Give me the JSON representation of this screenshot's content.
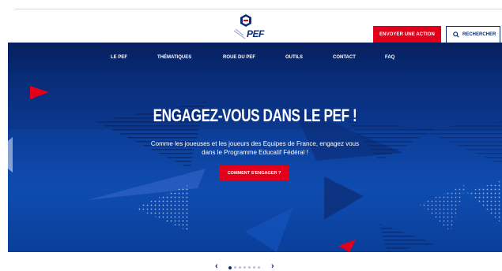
{
  "header": {
    "logo_text": "PEF",
    "primary_cta": "ENVOYER UNE ACTION",
    "search_label": "RECHERCHER"
  },
  "nav": {
    "items": [
      {
        "label": "LE PEF"
      },
      {
        "label": "THÉMATIQUES"
      },
      {
        "label": "ROUE DU PEF"
      },
      {
        "label": "OUTILS"
      },
      {
        "label": "CONTACT"
      },
      {
        "label": "FAQ"
      }
    ]
  },
  "hero": {
    "title": "ENGAGEZ-VOUS DANS LE PEF !",
    "subtitle_line1": "Comme les joueuses et les joueurs des Equipes de France, engagez vous",
    "subtitle_line2": "dans le Programme Educatif Fédéral !",
    "button_label": "COMMENT S'ENGAGER ?"
  },
  "carousel": {
    "prev": "‹",
    "next": "›",
    "slide_count": 7,
    "active_index": 0
  },
  "colors": {
    "brand_blue": "#0a2e73",
    "accent_red": "#e2001a"
  }
}
